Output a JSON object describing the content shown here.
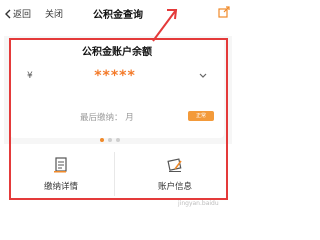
{
  "topbar": {
    "back_label": "返回",
    "close_label": "关闭",
    "title": "公积金查询"
  },
  "account_card": {
    "title": "公积金账户余额",
    "currency_symbol": "¥",
    "masked_balance": "*****",
    "last_payment_label": "最后缴纳：",
    "last_payment_value": "月",
    "badge": "正常"
  },
  "carousel": {
    "pages": 3,
    "active_index": 0
  },
  "options": [
    {
      "label": "缴纳详情",
      "icon": "document-icon"
    },
    {
      "label": "账户信息",
      "icon": "card-pen-icon"
    }
  ],
  "colors": {
    "accent": "#f37a2a",
    "annotation": "#e43a3a"
  }
}
